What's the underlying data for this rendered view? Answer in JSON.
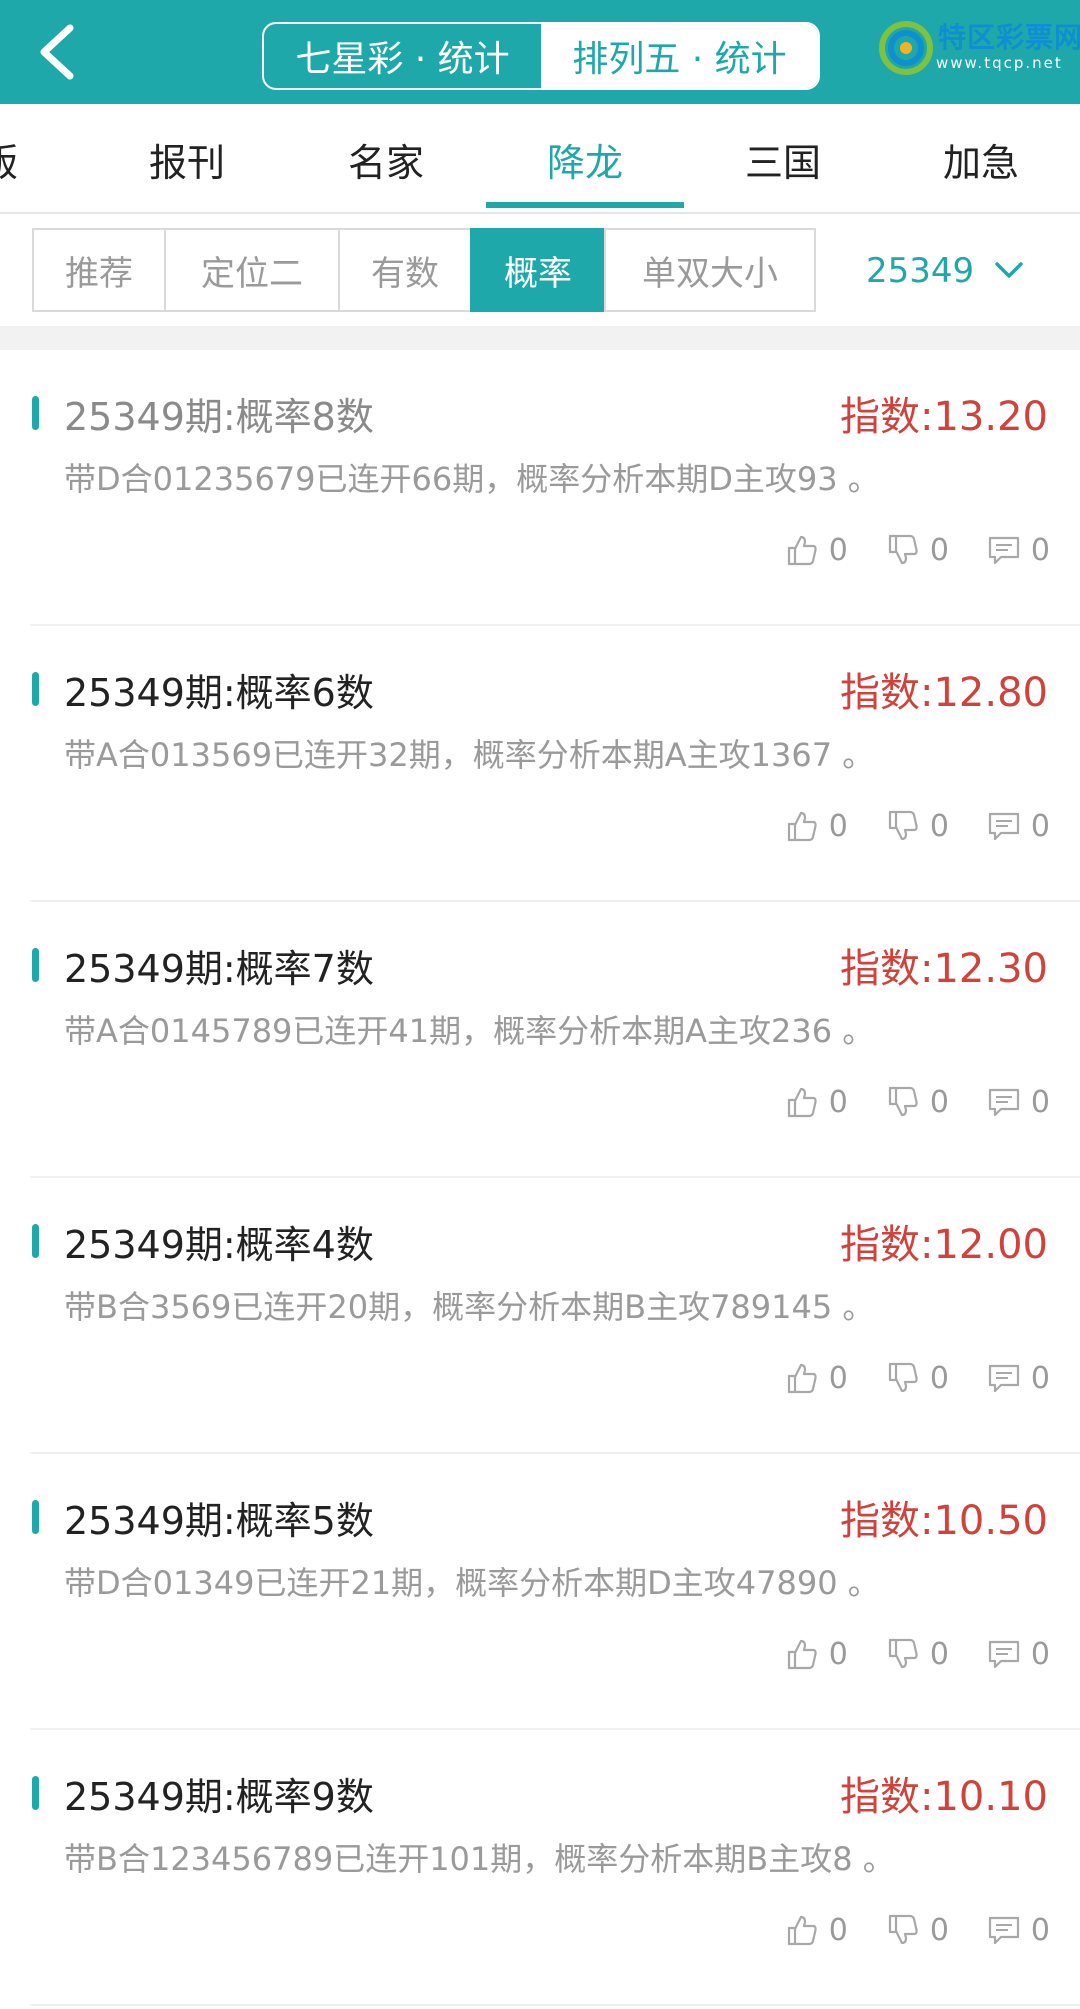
{
  "header": {
    "segments": [
      {
        "label": "七星彩 · 统计",
        "active": false
      },
      {
        "label": "排列五 · 统计",
        "active": true
      }
    ],
    "logo_text": "特区彩票网",
    "logo_url": "www.tqcp.net"
  },
  "tabs": [
    "版",
    "报刊",
    "名家",
    "降龙",
    "三国",
    "加急"
  ],
  "active_tab": "降龙",
  "chips": [
    "推荐",
    "定位二",
    "有数",
    "概率",
    "单双大小"
  ],
  "active_chip": "概率",
  "period_selector": "25349",
  "items": [
    {
      "title": "25349期:概率8数",
      "index": "指数:13.20",
      "desc": "带D合01235679已连开66期，概率分析本期D主攻93 。",
      "likes": "0",
      "dislikes": "0",
      "comments": "0",
      "read": true
    },
    {
      "title": "25349期:概率6数",
      "index": "指数:12.80",
      "desc": "带A合013569已连开32期，概率分析本期A主攻1367 。",
      "likes": "0",
      "dislikes": "0",
      "comments": "0",
      "read": false
    },
    {
      "title": "25349期:概率7数",
      "index": "指数:12.30",
      "desc": "带A合0145789已连开41期，概率分析本期A主攻236 。",
      "likes": "0",
      "dislikes": "0",
      "comments": "0",
      "read": false
    },
    {
      "title": "25349期:概率4数",
      "index": "指数:12.00",
      "desc": "带B合3569已连开20期，概率分析本期B主攻789145 。",
      "likes": "0",
      "dislikes": "0",
      "comments": "0",
      "read": false
    },
    {
      "title": "25349期:概率5数",
      "index": "指数:10.50",
      "desc": "带D合01349已连开21期，概率分析本期D主攻47890 。",
      "likes": "0",
      "dislikes": "0",
      "comments": "0",
      "read": false
    },
    {
      "title": "25349期:概率9数",
      "index": "指数:10.10",
      "desc": "带B合123456789已连开101期，概率分析本期B主攻8 。",
      "likes": "0",
      "dislikes": "0",
      "comments": "0",
      "read": false
    }
  ],
  "colors": {
    "accent": "#1fa8a9",
    "index_red": "#d0423c"
  }
}
